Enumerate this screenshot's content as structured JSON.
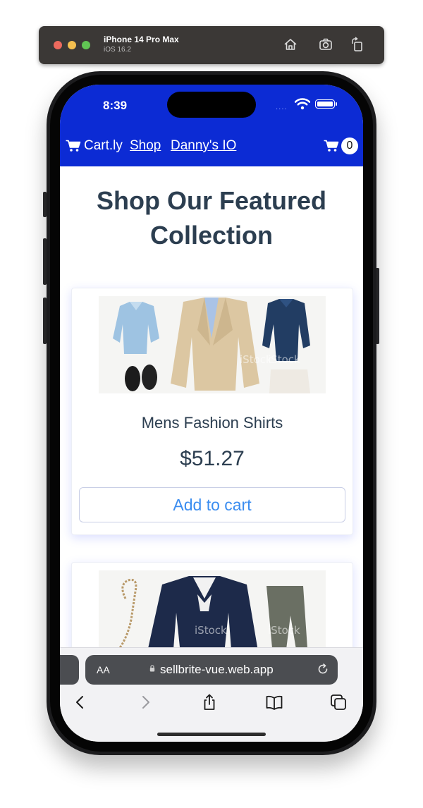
{
  "simulator": {
    "device": "iPhone 14 Pro Max",
    "os": "iOS 16.2",
    "icons": [
      "home-icon",
      "screenshot-icon",
      "rotate-icon"
    ]
  },
  "status_bar": {
    "time": "8:39",
    "signal": "....",
    "icons": [
      "wifi-icon",
      "battery-icon"
    ]
  },
  "navbar": {
    "brand": "Cart.ly",
    "links": [
      "Shop",
      "Danny's IO"
    ],
    "cart_count": "0",
    "colors": {
      "background": "#0c2bd4",
      "text": "#ffffff"
    }
  },
  "main": {
    "heading_line1": "Shop Our Featured",
    "heading_line2": "Collection"
  },
  "products": [
    {
      "name": "Mens Fashion Shirts",
      "price": "$51.27",
      "button": "Add to cart",
      "image_watermark": "iStock"
    },
    {
      "image_watermark": "iStock"
    }
  ],
  "safari": {
    "text_size_label": "AA",
    "url": "sellbrite-vue.web.app",
    "toolbar": [
      "back-icon",
      "forward-icon",
      "share-icon",
      "bookmarks-icon",
      "tabs-icon"
    ]
  },
  "colors": {
    "heading": "#2c3e50",
    "button_text": "#3b8df0",
    "card_shadow": "#5a6eff"
  }
}
